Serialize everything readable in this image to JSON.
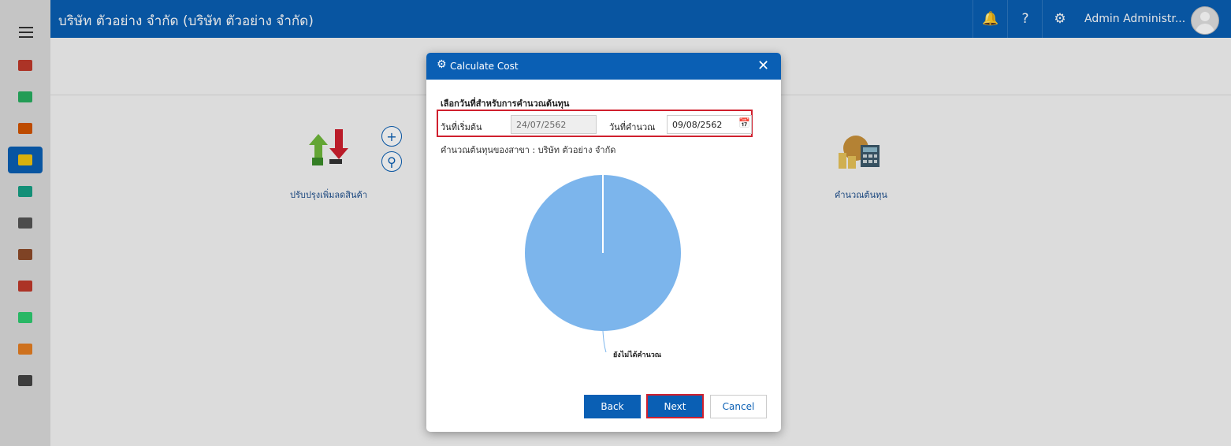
{
  "header": {
    "title": "บริษัท ตัวอย่าง จำกัด (บริษัท ตัวอย่าง จำกัด)",
    "user_name": "Admin Administr..."
  },
  "sidebar": {
    "items": [
      {
        "icon": "card-icon",
        "color": "#c0392b"
      },
      {
        "icon": "money-icon",
        "color": "#27ae60"
      },
      {
        "icon": "cart-icon",
        "color": "#d35400"
      },
      {
        "icon": "box-icon",
        "color": "#f1c40f",
        "active": true
      },
      {
        "icon": "book-icon",
        "color": "#16a085"
      },
      {
        "icon": "bank-icon",
        "color": "#555555"
      },
      {
        "icon": "wallet-icon",
        "color": "#8e4b2a"
      },
      {
        "icon": "user-icon",
        "color": "#c0392b"
      },
      {
        "icon": "check-icon",
        "color": "#2ecc71"
      },
      {
        "icon": "report-icon",
        "color": "#e67e22"
      },
      {
        "icon": "tools-icon",
        "color": "#444444"
      }
    ]
  },
  "background": {
    "tile_adjust_label": "ปรับปรุงเพิ่มลดสินค้า",
    "tile_cost_label": "คำนวณต้นทุน"
  },
  "modal": {
    "title": "Calculate Cost",
    "section_title": "เลือกวันที่สำหรับการคำนวณต้นทุน",
    "start_date_label": "วันที่เริ่มต้น",
    "start_date_value": "24/07/2562",
    "calc_date_label": "วันที่คำนวณ",
    "calc_date_value": "09/08/2562",
    "branch_text": "คำนวณต้นทุนของสาขา : บริษัท ตัวอย่าง จำกัด",
    "back_label": "Back",
    "next_label": "Next",
    "cancel_label": "Cancel"
  },
  "chart_data": {
    "type": "pie",
    "slices": [
      {
        "label": "ยังไม่ได้คำนวณ",
        "value": 100,
        "color": "#7cb5ec"
      }
    ]
  },
  "colors": {
    "primary": "#0a5fb4",
    "highlight": "#d0202e"
  }
}
